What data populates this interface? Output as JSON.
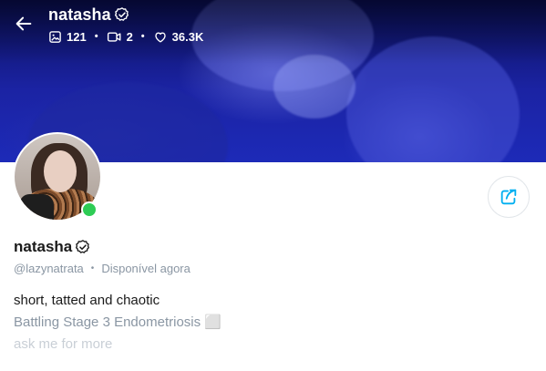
{
  "header": {
    "name": "natasha",
    "stats": {
      "photos": "121",
      "videos": "2",
      "likes": "36.3K"
    }
  },
  "profile": {
    "name": "natasha",
    "handle": "@lazynatrata",
    "status": "Disponível agora"
  },
  "bio": {
    "line1": "short, tatted and chaotic",
    "line2": "Battling Stage 3 Endometriosis ⬜",
    "line3": "ask me for more"
  },
  "colors": {
    "accent": "#00aff0",
    "online": "#2ecc55",
    "muted": "#8a96a3"
  },
  "icons": {
    "back": "arrow-left-icon",
    "verified": "verified-badge-icon",
    "photos": "image-icon",
    "videos": "video-icon",
    "likes": "heart-icon",
    "share": "share-icon"
  }
}
